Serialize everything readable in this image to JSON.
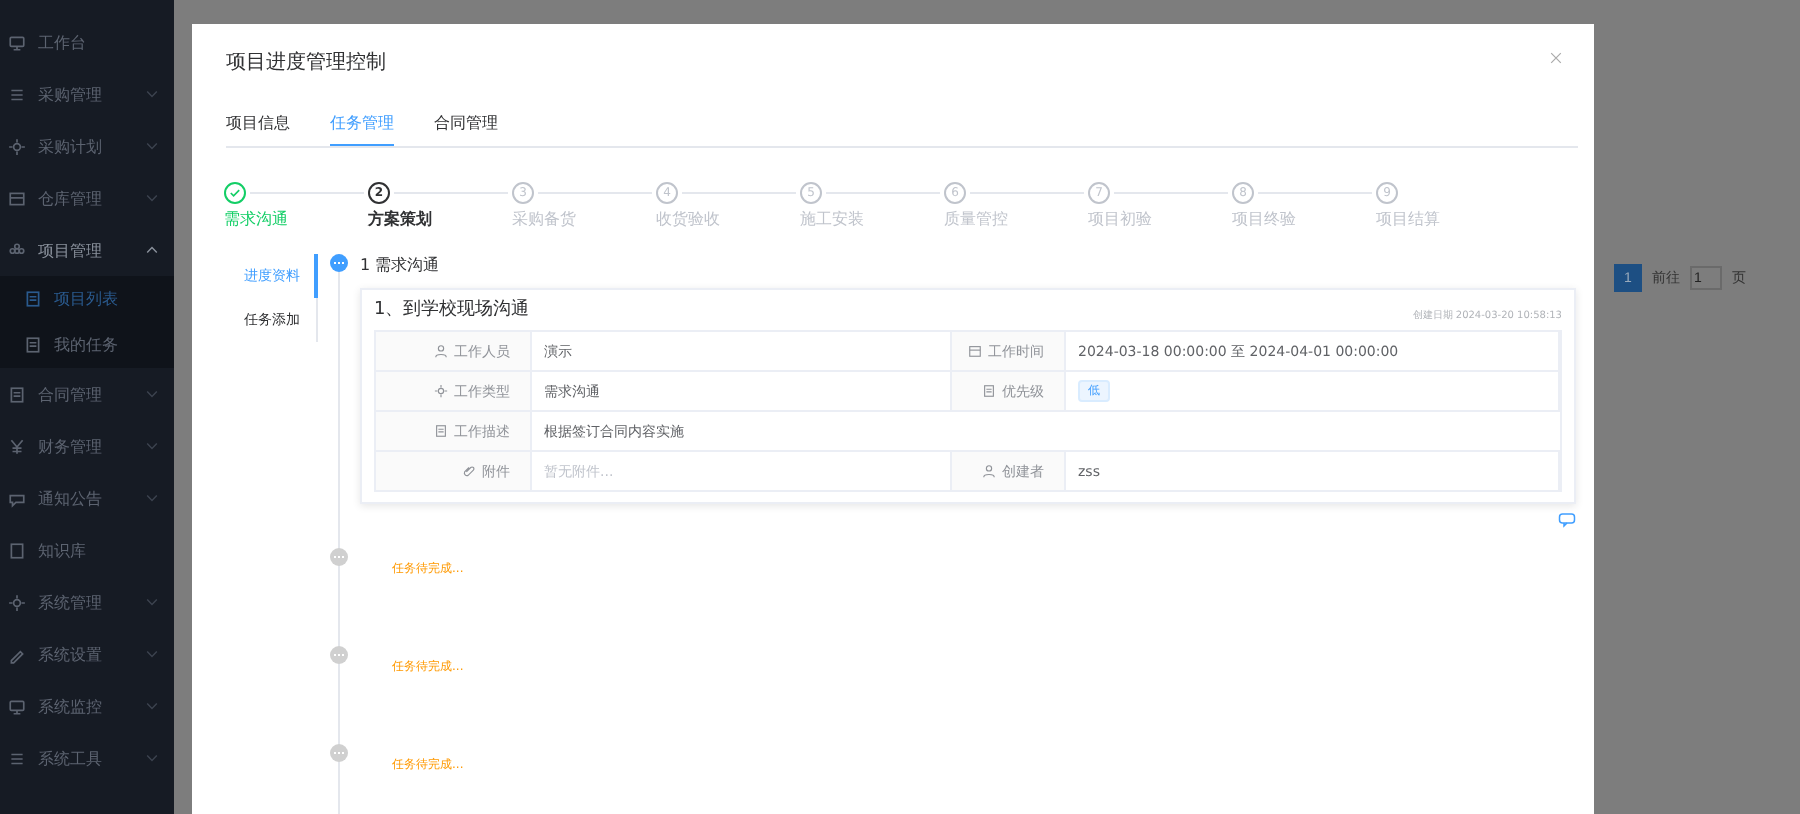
{
  "sidebar": {
    "items": [
      {
        "label": "工作台",
        "kind": "link"
      },
      {
        "label": "采购管理",
        "kind": "group",
        "expanded": false
      },
      {
        "label": "采购计划",
        "kind": "group",
        "expanded": false
      },
      {
        "label": "仓库管理",
        "kind": "group",
        "expanded": false
      },
      {
        "label": "项目管理",
        "kind": "group",
        "expanded": true,
        "children": [
          {
            "label": "项目列表",
            "selected": true
          },
          {
            "label": "我的任务",
            "selected": false
          }
        ]
      },
      {
        "label": "合同管理",
        "kind": "group",
        "expanded": false
      },
      {
        "label": "财务管理",
        "kind": "group",
        "expanded": false
      },
      {
        "label": "通知公告",
        "kind": "group",
        "expanded": false
      },
      {
        "label": "知识库",
        "kind": "link"
      },
      {
        "label": "系统管理",
        "kind": "group",
        "expanded": false
      },
      {
        "label": "系统设置",
        "kind": "group",
        "expanded": false
      },
      {
        "label": "系统监控",
        "kind": "group",
        "expanded": false
      },
      {
        "label": "系统工具",
        "kind": "group",
        "expanded": false
      }
    ]
  },
  "pagination": {
    "pages": [
      {
        "label": "1",
        "selected": true
      }
    ],
    "goto_label": "前往",
    "goto_value": "1",
    "page_unit": "页"
  },
  "modal": {
    "title": "项目进度管理控制",
    "tabs": [
      {
        "label": "项目信息",
        "selected": false
      },
      {
        "label": "任务管理",
        "selected": true
      },
      {
        "label": "合同管理",
        "selected": false
      }
    ],
    "steps": [
      {
        "label": "需求沟通",
        "kind": "finish"
      },
      {
        "number": "2",
        "label": "方案策划",
        "kind": "process"
      },
      {
        "number": "3",
        "label": "采购备货",
        "kind": "wait"
      },
      {
        "number": "4",
        "label": "收货验收",
        "kind": "wait"
      },
      {
        "number": "5",
        "label": "施工安装",
        "kind": "wait"
      },
      {
        "number": "6",
        "label": "质量管控",
        "kind": "wait"
      },
      {
        "number": "7",
        "label": "项目初验",
        "kind": "wait"
      },
      {
        "number": "8",
        "label": "项目终验",
        "kind": "wait"
      },
      {
        "number": "9",
        "label": "项目结算",
        "kind": "wait"
      }
    ],
    "side_tabs": [
      {
        "label": "进度资料",
        "selected": true
      },
      {
        "label": "任务添加",
        "selected": false
      }
    ],
    "timeline": [
      {
        "kind": "stage",
        "title": "1 需求沟通",
        "card": {
          "title": "1、到学校现场沟通",
          "created_label": "创建日期",
          "created": "2024-03-20 10:58:13",
          "rows": [
            [
              {
                "label": "工作人员",
                "value": "演示"
              },
              {
                "label": "工作时间",
                "value": "2024-03-18 00:00:00 至 2024-04-01 00:00:00"
              }
            ],
            [
              {
                "label": "工作类型",
                "value": "需求沟通"
              },
              {
                "label": "优先级",
                "tag": "低"
              }
            ],
            [
              {
                "label": "工作描述",
                "value": "根据签订合同内容实施"
              }
            ],
            [
              {
                "label": "附件",
                "placeholder": "暂无附件..."
              },
              {
                "label": "创建者",
                "value": "zss"
              }
            ]
          ]
        }
      },
      {
        "kind": "pending",
        "text": "任务待完成..."
      },
      {
        "kind": "pending",
        "text": "任务待完成..."
      },
      {
        "kind": "pending",
        "text": "任务待完成..."
      }
    ]
  }
}
